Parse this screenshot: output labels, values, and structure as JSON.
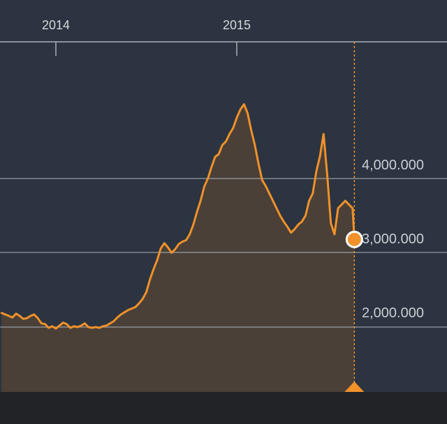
{
  "colors": {
    "background": "#2b3440",
    "line": "#f0912a",
    "area": "#4a4038",
    "grid": "#aab0b8",
    "bottom_bar": "#222326"
  },
  "chart_data": {
    "type": "area",
    "x_tick_labels": [
      "2014",
      "2015"
    ],
    "y_tick_labels": [
      "2,000.000",
      "3,000.000",
      "4,000.000"
    ],
    "y_ticks": [
      2000,
      3000,
      4000
    ],
    "ylim": [
      1100,
      5150
    ],
    "xlim": [
      2013.7,
      2016.15
    ],
    "grid": true,
    "cursor": {
      "x": 2015.65,
      "value": 3180
    },
    "series": [
      {
        "x": [
          2013.7,
          2013.72,
          2013.74,
          2013.76,
          2013.78,
          2013.8,
          2013.82,
          2013.84,
          2013.86,
          2013.88,
          2013.9,
          2013.92,
          2013.94,
          2013.96,
          2013.98,
          2014.0,
          2014.02,
          2014.04,
          2014.06,
          2014.08,
          2014.1,
          2014.12,
          2014.14,
          2014.16,
          2014.18,
          2014.2,
          2014.22,
          2014.24,
          2014.26,
          2014.28,
          2014.3,
          2014.32,
          2014.34,
          2014.36,
          2014.38,
          2014.4,
          2014.42,
          2014.44,
          2014.46,
          2014.48,
          2014.5,
          2014.52,
          2014.54,
          2014.56,
          2014.58,
          2014.6,
          2014.62,
          2014.64,
          2014.66,
          2014.68,
          2014.7,
          2014.72,
          2014.74,
          2014.76,
          2014.78,
          2014.8,
          2014.82,
          2014.84,
          2014.86,
          2014.88,
          2014.9,
          2014.92,
          2014.94,
          2014.96,
          2014.98,
          2015.0,
          2015.02,
          2015.04,
          2015.06,
          2015.08,
          2015.1,
          2015.12,
          2015.14,
          2015.16,
          2015.18,
          2015.2,
          2015.22,
          2015.24,
          2015.26,
          2015.28,
          2015.3,
          2015.32,
          2015.34,
          2015.36,
          2015.38,
          2015.4,
          2015.42,
          2015.44,
          2015.46,
          2015.48,
          2015.5,
          2015.52,
          2015.54,
          2015.56,
          2015.58,
          2015.6,
          2015.62,
          2015.64,
          2015.65
        ],
        "values": [
          2190,
          2170,
          2150,
          2130,
          2180,
          2150,
          2110,
          2120,
          2150,
          2170,
          2120,
          2050,
          2040,
          1990,
          2010,
          1980,
          2020,
          2060,
          2040,
          1990,
          2010,
          2000,
          2020,
          2050,
          2000,
          1990,
          2000,
          1990,
          2010,
          2020,
          2050,
          2080,
          2130,
          2170,
          2200,
          2230,
          2250,
          2270,
          2320,
          2380,
          2470,
          2640,
          2780,
          2900,
          3060,
          3130,
          3070,
          3000,
          3050,
          3120,
          3150,
          3170,
          3250,
          3380,
          3550,
          3700,
          3890,
          4000,
          4150,
          4290,
          4330,
          4450,
          4500,
          4600,
          4680,
          4820,
          4930,
          5000,
          4880,
          4650,
          4450,
          4200,
          3980,
          3900,
          3800,
          3700,
          3600,
          3500,
          3420,
          3350,
          3270,
          3320,
          3380,
          3420,
          3500,
          3700,
          3800,
          4100,
          4300,
          4600,
          4050,
          3400,
          3250,
          3600,
          3650,
          3700,
          3650,
          3600,
          3180
        ]
      }
    ]
  }
}
